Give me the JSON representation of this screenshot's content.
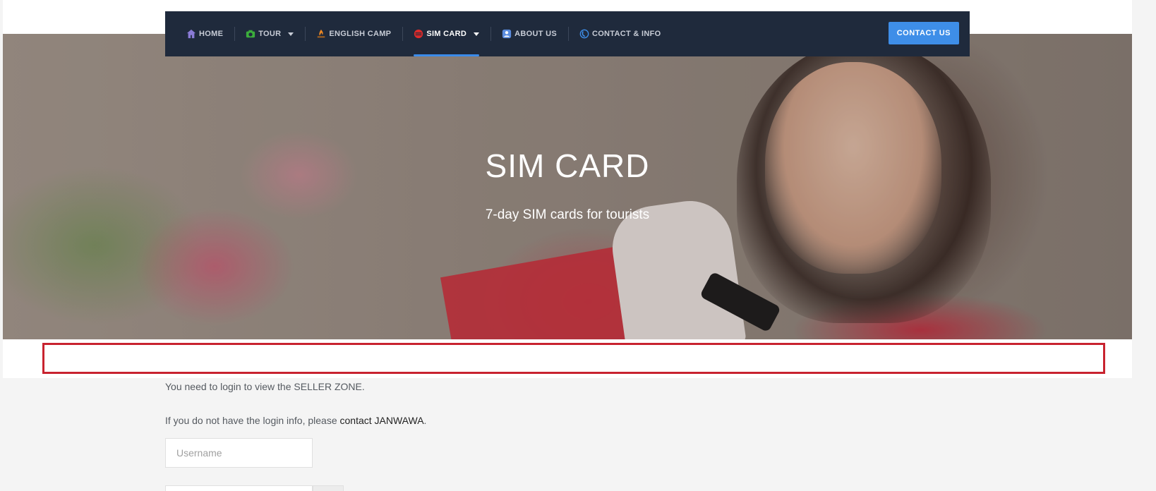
{
  "nav": {
    "items": [
      {
        "label": "HOME",
        "icon": "home-icon",
        "color": "#8a7bd6"
      },
      {
        "label": "TOUR",
        "icon": "camera-icon",
        "color": "#3cae3c",
        "dropdown": true
      },
      {
        "label": "ENGLISH CAMP",
        "icon": "campfire-icon",
        "color": "#f08a24"
      },
      {
        "label": "SIM CARD",
        "icon": "sim-card-icon",
        "color": "#e02a2a",
        "dropdown": true,
        "active": true
      },
      {
        "label": "ABOUT US",
        "icon": "user-icon",
        "color": "#5b8de0"
      },
      {
        "label": "CONTACT & INFO",
        "icon": "phone-icon",
        "color": "#3e8ee8"
      }
    ],
    "contact_button": "CONTACT US"
  },
  "hero": {
    "title": "SIM CARD",
    "subtitle": "7-day SIM cards for tourists"
  },
  "content": {
    "login_notice": "You need to login to view the SELLER ZONE.",
    "no_info_prefix": "If you do not have the login info, please ",
    "no_info_link": "contact JANWAWA",
    "no_info_suffix": ".",
    "username_placeholder": "Username"
  },
  "colors": {
    "nav_bg": "#1f2a3c",
    "accent": "#3e8ee8",
    "highlight_box": "#c8232f"
  }
}
